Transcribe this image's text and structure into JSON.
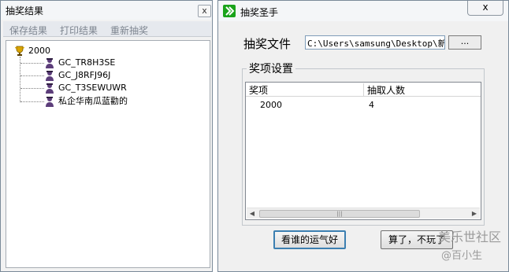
{
  "left_window": {
    "title": "抽奖结果",
    "close_label": "x",
    "menu": [
      "保存结果",
      "打印结果",
      "重新抽奖"
    ],
    "tree": {
      "root": "2000",
      "children": [
        "GC_TR8H3SE",
        "GC_J8RFJ96J",
        "GC_T3SEWUWR",
        "私企华南瓜蓝勸的"
      ]
    }
  },
  "right_window": {
    "title": "抽奖圣手",
    "close_label": "x",
    "file_label": "抽奖文件",
    "file_path": "C:\\Users\\samsung\\Desktop\\新建",
    "browse_label": "...",
    "group_title": "奖项设置",
    "columns": [
      "奖项",
      "抽取人数"
    ],
    "rows": [
      {
        "prize": "2000",
        "count": "4"
      }
    ],
    "scroll_thumb_grip": "|||",
    "scroll_left": "◀",
    "scroll_right": "▶",
    "button_luck": "看谁的运气好",
    "button_quit": "算了，不玩了"
  },
  "watermark": {
    "line1": "美乐世社区",
    "line2": "@百小生"
  }
}
